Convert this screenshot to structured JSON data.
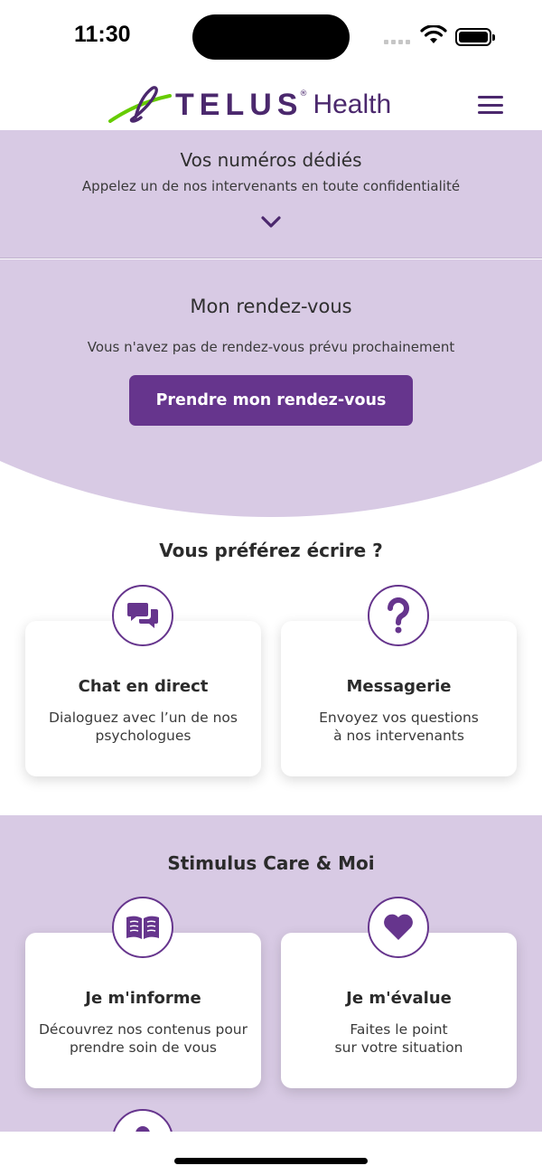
{
  "status_bar": {
    "time": "11:30"
  },
  "header": {
    "logo_main": "TELUS",
    "logo_mark": "®",
    "logo_sub": "Health"
  },
  "numbers": {
    "title": "Vos numéros dédiés",
    "subtitle": "Appelez un de nos intervenants en toute confidentialité"
  },
  "appointment": {
    "title": "Mon rendez-vous",
    "message": "Vous n'avez pas de rendez-vous prévu prochainement",
    "button": "Prendre mon rendez-vous"
  },
  "write": {
    "title": "Vous préférez écrire ?",
    "cards": [
      {
        "title": "Chat en direct",
        "line1": "Dialoguez avec l’un de nos",
        "line2": "psychologues",
        "icon": "chat-icon"
      },
      {
        "title": "Messagerie",
        "line1": "Envoyez vos questions",
        "line2": "à nos intervenants",
        "icon": "question-icon"
      }
    ]
  },
  "stimulus": {
    "title": "Stimulus Care & Moi",
    "cards": [
      {
        "title": "Je m'informe",
        "line1": "Découvrez nos contenus pour",
        "line2": "prendre soin de vous",
        "icon": "book-icon"
      },
      {
        "title": "Je m'évalue",
        "line1": "Faites le point",
        "line2": "sur votre situation",
        "icon": "heart-icon"
      }
    ]
  },
  "colors": {
    "brand_purple": "#4b286d",
    "button_purple": "#66358d",
    "panel_lavender": "#d8cae4",
    "logo_green": "#66cc00"
  }
}
